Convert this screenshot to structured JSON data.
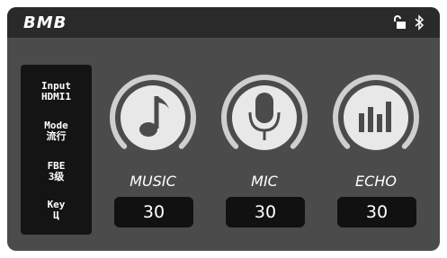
{
  "header": {
    "brand": "BMB"
  },
  "status_panel": {
    "input_label": "Input",
    "input_value": "HDMI1",
    "mode_label": "Mode",
    "mode_value": "流行",
    "fbe_label": "FBE",
    "fbe_value": "3级",
    "key_label": "Key",
    "key_value": "Ц"
  },
  "controls": [
    {
      "label": "MUSIC",
      "value": "30",
      "icon": "music-note-icon"
    },
    {
      "label": "MIC",
      "value": "30",
      "icon": "microphone-icon"
    },
    {
      "label": "ECHO",
      "value": "30",
      "icon": "echo-bars-icon"
    }
  ],
  "icons": {
    "lock": "unlocked-padlock-icon",
    "bluetooth": "bluetooth-icon"
  },
  "colors": {
    "panel_bg": "#4b4b4b",
    "topbar_bg": "#2a2a2a",
    "knob_face": "#e8e8e8",
    "arc": "#cfcfcf"
  }
}
